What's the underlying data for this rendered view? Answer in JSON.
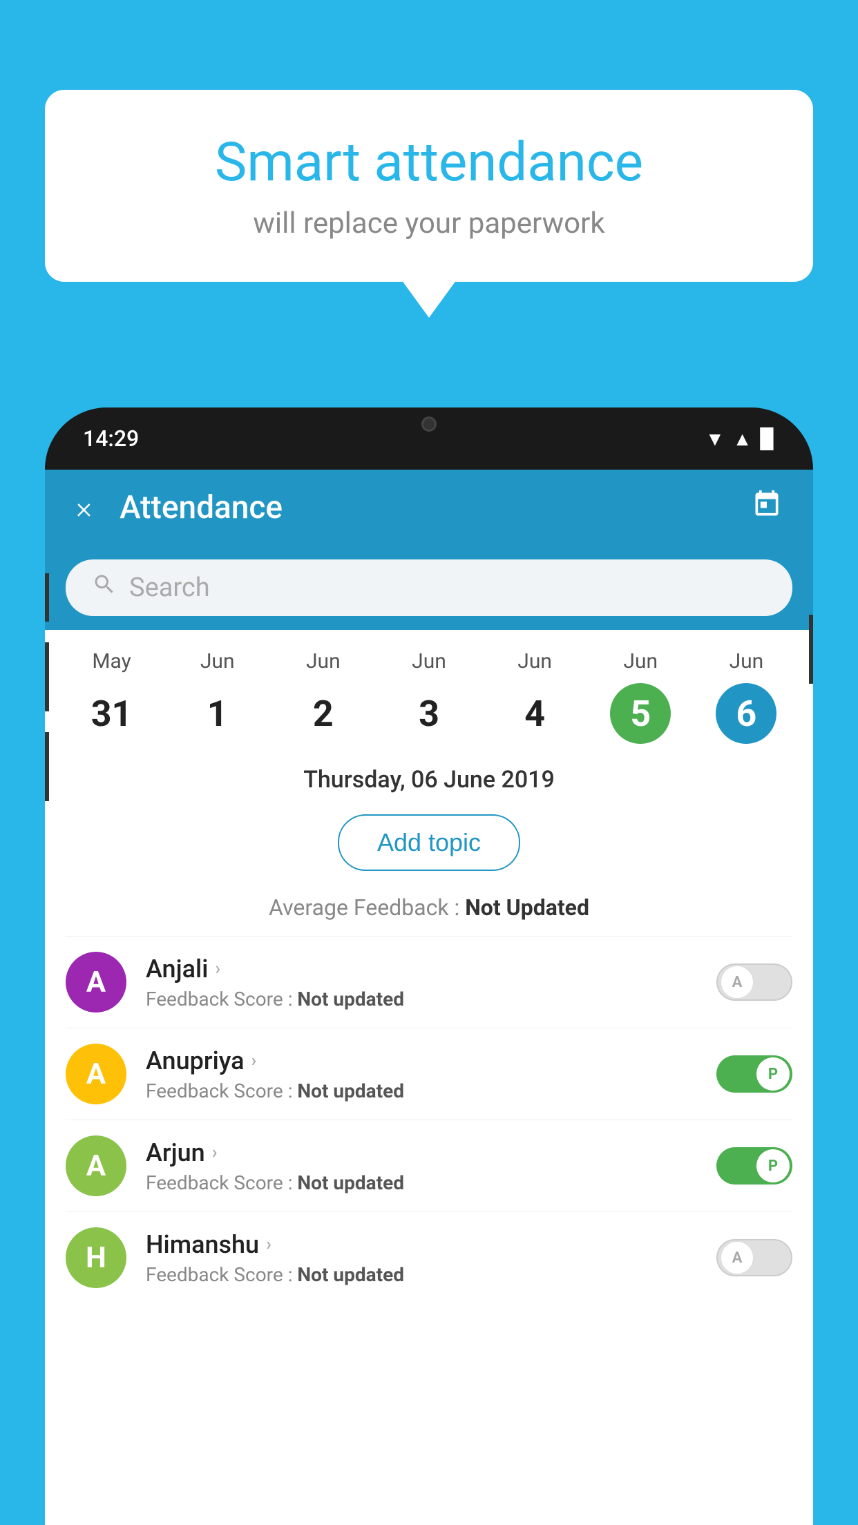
{
  "background_color": "#29b6e8",
  "speech_bubble": {
    "title": "Smart attendance",
    "subtitle": "will replace your paperwork"
  },
  "phone": {
    "status_bar": {
      "time": "14:29"
    },
    "header": {
      "title": "Attendance",
      "close_label": "×",
      "calendar_icon": "📅"
    },
    "search": {
      "placeholder": "Search"
    },
    "calendar": {
      "days": [
        {
          "month": "May",
          "date": "31",
          "type": "normal"
        },
        {
          "month": "Jun",
          "date": "1",
          "type": "normal"
        },
        {
          "month": "Jun",
          "date": "2",
          "type": "normal"
        },
        {
          "month": "Jun",
          "date": "3",
          "type": "normal"
        },
        {
          "month": "Jun",
          "date": "4",
          "type": "normal"
        },
        {
          "month": "Jun",
          "date": "5",
          "type": "today"
        },
        {
          "month": "Jun",
          "date": "6",
          "type": "selected"
        }
      ]
    },
    "selected_date_label": "Thursday, 06 June 2019",
    "add_topic_label": "Add topic",
    "avg_feedback_label": "Average Feedback : ",
    "avg_feedback_value": "Not Updated",
    "students": [
      {
        "name": "Anjali",
        "initial": "A",
        "avatar_color": "#9c27b0",
        "feedback_label": "Feedback Score : ",
        "feedback_value": "Not updated",
        "toggle_state": "off",
        "toggle_label": "A"
      },
      {
        "name": "Anupriya",
        "initial": "A",
        "avatar_color": "#ffc107",
        "feedback_label": "Feedback Score : ",
        "feedback_value": "Not updated",
        "toggle_state": "on",
        "toggle_label": "P"
      },
      {
        "name": "Arjun",
        "initial": "A",
        "avatar_color": "#8bc34a",
        "feedback_label": "Feedback Score : ",
        "feedback_value": "Not updated",
        "toggle_state": "on",
        "toggle_label": "P"
      },
      {
        "name": "Himanshu",
        "initial": "H",
        "avatar_color": "#8bc34a",
        "feedback_label": "Feedback Score : ",
        "feedback_value": "Not updated",
        "toggle_state": "off",
        "toggle_label": "A"
      }
    ]
  }
}
